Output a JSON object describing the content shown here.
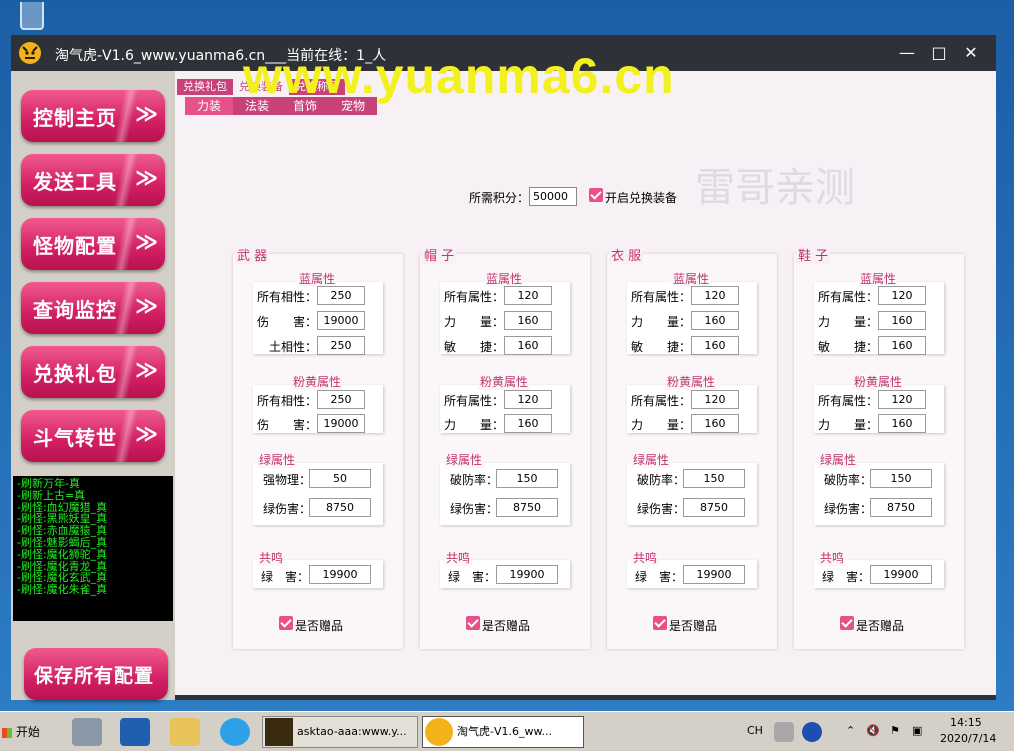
{
  "window": {
    "title": "淘气虎-V1.6_www.yuanma6.cn___当前在线：1_人",
    "minimize": "—",
    "maximize": "□",
    "close": "✕"
  },
  "watermark": {
    "main": "www.yuanma6.cn",
    "sub": "雷哥亲测"
  },
  "sidebar": {
    "items": [
      {
        "label": "控制主页"
      },
      {
        "label": "发送工具"
      },
      {
        "label": "怪物配置"
      },
      {
        "label": "查询监控"
      },
      {
        "label": "兑换礼包"
      },
      {
        "label": "斗气转世"
      }
    ],
    "chevron": "≫",
    "log": [
      "-刷新万年-真",
      "-刷新上古=真",
      "-刷怪:血幻魔猎_真",
      "-刷怪:黑熊妖皇_真",
      "-刷怪:赤血魔猿_真",
      "-刷怪:魅影蝎后_真",
      "-刷怪:魔化狮驼_真",
      "-刷怪:魔化青龙_真",
      "-刷怪:魔化玄武_真",
      "-刷怪:魔化朱雀_真"
    ],
    "save_label": "保存所有配置"
  },
  "tabs_top": [
    {
      "label": "兑换礼包",
      "active": false
    },
    {
      "label": "兑换装备",
      "active": true
    },
    {
      "label": "兑换称号",
      "active": false
    }
  ],
  "tabs_sub": [
    {
      "label": "力装",
      "active": true
    },
    {
      "label": "法装",
      "active": false
    },
    {
      "label": "首饰",
      "active": false
    },
    {
      "label": "宠物",
      "active": false
    }
  ],
  "points": {
    "label": "所需积分：",
    "value": "50000",
    "enable_label": "开启兑换装备",
    "enable_checked": true
  },
  "groups": [
    {
      "title": "武 器",
      "blue_title": "蓝属性",
      "blue": [
        {
          "label": "所有相性：",
          "value": "250"
        },
        {
          "label": "伤　　害：",
          "value": "19000"
        },
        {
          "label": "土相性：",
          "value": "250"
        }
      ],
      "pink_title": "粉黄属性",
      "pink": [
        {
          "label": "所有相性：",
          "value": "250"
        },
        {
          "label": "伤　　害：",
          "value": "19000"
        }
      ],
      "green_title": "绿属性",
      "green": [
        {
          "label": "强物理：",
          "value": "50"
        },
        {
          "label": "绿伤害：",
          "value": "8750"
        }
      ],
      "res_title": "共鸣",
      "res": {
        "label": "绿　害：",
        "value": "19900"
      },
      "gift_label": "是否赠品",
      "gift_checked": true
    },
    {
      "title": "帽 子",
      "blue_title": "蓝属性",
      "blue": [
        {
          "label": "所有属性：",
          "value": "120"
        },
        {
          "label": "力　　量：",
          "value": "160"
        },
        {
          "label": "敏　　捷：",
          "value": "160"
        }
      ],
      "pink_title": "粉黄属性",
      "pink": [
        {
          "label": "所有属性：",
          "value": "120"
        },
        {
          "label": "力　　量：",
          "value": "160"
        }
      ],
      "green_title": "绿属性",
      "green": [
        {
          "label": "破防率：",
          "value": "150"
        },
        {
          "label": "绿伤害：",
          "value": "8750"
        }
      ],
      "res_title": "共鸣",
      "res": {
        "label": "绿　害：",
        "value": "19900"
      },
      "gift_label": "是否赠品",
      "gift_checked": true
    },
    {
      "title": "衣 服",
      "blue_title": "蓝属性",
      "blue": [
        {
          "label": "所有属性：",
          "value": "120"
        },
        {
          "label": "力　　量：",
          "value": "160"
        },
        {
          "label": "敏　　捷：",
          "value": "160"
        }
      ],
      "pink_title": "粉黄属性",
      "pink": [
        {
          "label": "所有属性：",
          "value": "120"
        },
        {
          "label": "力　　量：",
          "value": "160"
        }
      ],
      "green_title": "绿属性",
      "green": [
        {
          "label": "破防率：",
          "value": "150"
        },
        {
          "label": "绿伤害：",
          "value": "8750"
        }
      ],
      "res_title": "共鸣",
      "res": {
        "label": "绿　害：",
        "value": "19900"
      },
      "gift_label": "是否赠品",
      "gift_checked": true
    },
    {
      "title": "鞋 子",
      "blue_title": "蓝属性",
      "blue": [
        {
          "label": "所有属性：",
          "value": "120"
        },
        {
          "label": "力　　量：",
          "value": "160"
        },
        {
          "label": "敏　　捷：",
          "value": "160"
        }
      ],
      "pink_title": "粉黄属性",
      "pink": [
        {
          "label": "所有属性：",
          "value": "120"
        },
        {
          "label": "力　　量：",
          "value": "160"
        }
      ],
      "green_title": "绿属性",
      "green": [
        {
          "label": "破防率：",
          "value": "150"
        },
        {
          "label": "绿伤害：",
          "value": "8750"
        }
      ],
      "res_title": "共鸣",
      "res": {
        "label": "绿　害：",
        "value": "19900"
      },
      "gift_label": "是否赠品",
      "gift_checked": true
    }
  ],
  "taskbar": {
    "start_label": "开始",
    "tasks": [
      {
        "label": "asktao-aaa:www.y..."
      },
      {
        "label": "淘气虎-V1.6_ww..."
      }
    ],
    "lang": "CH",
    "time": "14:15",
    "date": "2020/7/14"
  },
  "colors": {
    "accent": "#d21f64",
    "tab": "#c8427a",
    "log_text": "#22ee22",
    "watermark": "#f3f020"
  }
}
